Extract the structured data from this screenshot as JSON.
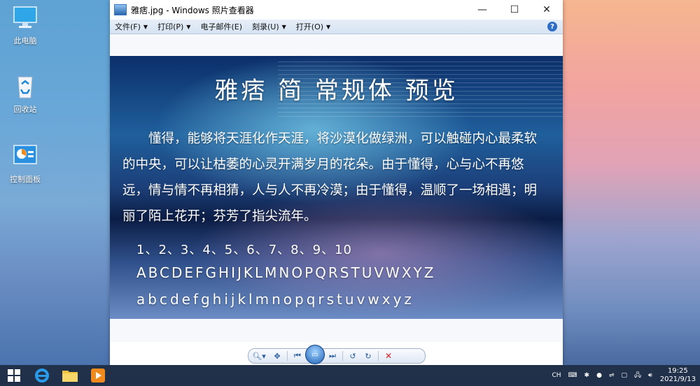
{
  "desktop": {
    "icons": [
      {
        "label": "此电脑"
      },
      {
        "label": "回收站"
      },
      {
        "label": "控制面板"
      }
    ]
  },
  "window": {
    "title": "雅痞.jpg - Windows 照片查看器",
    "controls": {
      "minimize": "—",
      "maximize": "☐",
      "close": "✕"
    },
    "menu": [
      {
        "label": "文件(F)"
      },
      {
        "label": "打印(P)"
      },
      {
        "label": "电子邮件(E)"
      },
      {
        "label": "刻录(U)"
      },
      {
        "label": "打开(O)"
      }
    ],
    "help": "?"
  },
  "image": {
    "title": "雅痞 简 常规体 预览",
    "body": "懂得，能够将天涯化作天涯，将沙漠化做绿洲，可以触碰内心最柔软的中央，可以让枯萎的心灵开满岁月的花朵。由于懂得，心与心不再悠远，情与情不再相猜，人与人不再冷漠；由于懂得，温顺了一场相遇；明丽了陌上花开；芬芳了指尖流年。",
    "numbers": "1、2、3、4、5、6、7、8、9、10",
    "uppercase": "ABCDEFGHIJKLMNOPQRSTUVWXYZ",
    "lowercase": "abcdefghijklmnopqrstuvwxyz"
  },
  "taskbar": {
    "lang": "CH",
    "time": "19:25",
    "date": "2021/9/13"
  }
}
